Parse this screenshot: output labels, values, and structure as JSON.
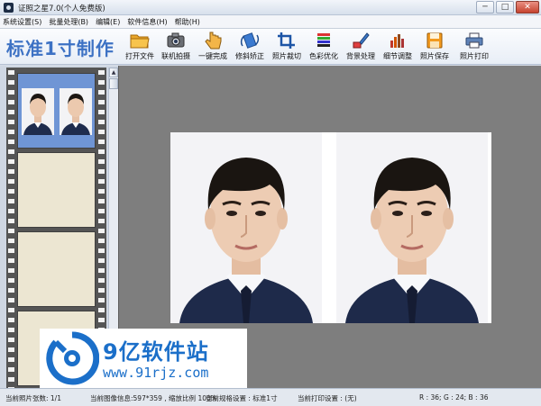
{
  "window": {
    "title": "证照之星7.0(个人免费版)",
    "minimize": "─",
    "maximize": "□",
    "close": "✕"
  },
  "menu": [
    "系统设置(S)",
    "批量处理(B)",
    "编辑(E)",
    "软件信息(H)",
    "帮助(H)"
  ],
  "brand": "标准1寸制作",
  "toolbar": [
    {
      "label": "打开文件",
      "icon": "folder-icon"
    },
    {
      "label": "联机拍摄",
      "icon": "camera-icon"
    },
    {
      "label": "一键完成",
      "icon": "hand-click-icon"
    },
    {
      "label": "修斜矫正",
      "icon": "rotate-icon"
    },
    {
      "label": "照片裁切",
      "icon": "crop-icon"
    },
    {
      "label": "色彩优化",
      "icon": "color-icon"
    },
    {
      "label": "背景处理",
      "icon": "brush-icon"
    },
    {
      "label": "细节调整",
      "icon": "levels-icon"
    },
    {
      "label": "照片保存",
      "icon": "save-icon"
    },
    {
      "label": "照片打印",
      "icon": "printer-icon"
    }
  ],
  "status": {
    "count": "当前照片张数: 1/1",
    "image_info": "当前图像信息:597*359 , 缩放比例 100%",
    "spec": "当前规格设置 : 标准1寸",
    "print": "当前打印设置 : (无)",
    "rgb": "R : 36; G : 24; B : 36"
  },
  "watermark": {
    "text": "9亿软件站",
    "url": "www.91rjz.com"
  },
  "colors": {
    "accent": "#3d72c4",
    "selected_frame": "#6f95d5",
    "canvas": "#7e7e7e"
  }
}
